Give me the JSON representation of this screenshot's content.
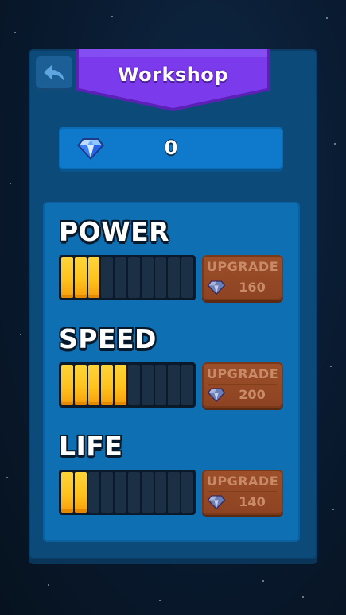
{
  "header": {
    "title": "Workshop",
    "back_icon": "back-arrow-icon"
  },
  "currency": {
    "icon": "diamond-gem-icon",
    "count": "0"
  },
  "stats": [
    {
      "label": "POWER",
      "level": 3,
      "max_level": 10,
      "upgrade_label": "UPGRADE",
      "cost": "160"
    },
    {
      "label": "SPEED",
      "level": 5,
      "max_level": 10,
      "upgrade_label": "UPGRADE",
      "cost": "200"
    },
    {
      "label": "LIFE",
      "level": 2,
      "max_level": 10,
      "upgrade_label": "UPGRADE",
      "cost": "140"
    }
  ],
  "colors": {
    "banner_purple": "#7c3aed",
    "panel_blue": "#0c4a7a",
    "meter_fill": "#ffc21d",
    "upgrade_brown": "#8d4322"
  }
}
